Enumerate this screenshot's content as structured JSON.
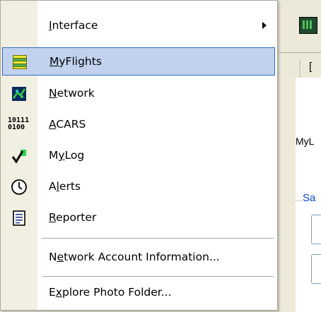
{
  "background": {
    "fragments": [
      "[",
      "MyL",
      "Sa"
    ]
  },
  "menu": {
    "items": [
      {
        "label": "Interface",
        "accel": "I",
        "rest": "nterface",
        "icon": "none",
        "has_submenu": true
      },
      {
        "label": "MyFlights",
        "accel": "M",
        "rest": "yFlights",
        "icon": "flight-strip-icon",
        "highlighted": true
      },
      {
        "label": "Network",
        "accel": "N",
        "rest": "etwork",
        "icon": "network-radar-icon"
      },
      {
        "label": "ACARS",
        "accel": "A",
        "rest": "CARS",
        "icon": "binary-digits-icon"
      },
      {
        "label": "MyLog",
        "pre": "M",
        "accel": "y",
        "rest": "Log",
        "icon": "checkmark-icon"
      },
      {
        "label": "Alerts",
        "pre": "A",
        "accel": "l",
        "rest": "erts",
        "icon": "clock-icon"
      },
      {
        "label": "Reporter",
        "accel": "R",
        "rest": "eporter",
        "icon": "document-icon"
      },
      {
        "label": "Network Account Information...",
        "pre": "N",
        "accel": "e",
        "rest": "twork Account Information..."
      },
      {
        "label": "Explore Photo Folder...",
        "pre": "E",
        "accel": "x",
        "rest": "plore Photo Folder..."
      }
    ],
    "binary_icon_text": [
      "10111",
      "0100"
    ]
  },
  "colors": {
    "highlight_bg": "#c1d2ee",
    "highlight_border": "#316ac5",
    "icon_column": "#f1efe2"
  }
}
